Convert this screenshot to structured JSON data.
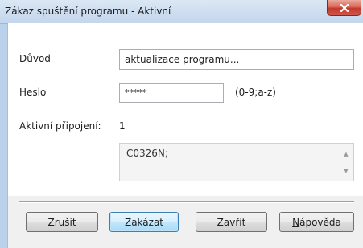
{
  "window": {
    "title": "Zákaz spuštění programu - Aktivní",
    "close_glyph": "x"
  },
  "form": {
    "reason_label": "Důvod",
    "reason_value": "aktualizace programu...",
    "password_label": "Heslo",
    "password_value": "*****",
    "password_hint": "(0-9;a-z)",
    "active_connections_label": "Aktivní připojení:",
    "active_connections_count": "1",
    "connections_list": [
      "C0326N;"
    ]
  },
  "buttons": {
    "cancel": "Zrušit",
    "forbid": "Zakázat",
    "close": "Zavřít",
    "help_underlined": "N",
    "help_rest": "ápověda"
  },
  "colors": {
    "titlebar": "#c3d6ec",
    "close_button": "#c4382a",
    "default_button_border": "#3c7fb1"
  }
}
